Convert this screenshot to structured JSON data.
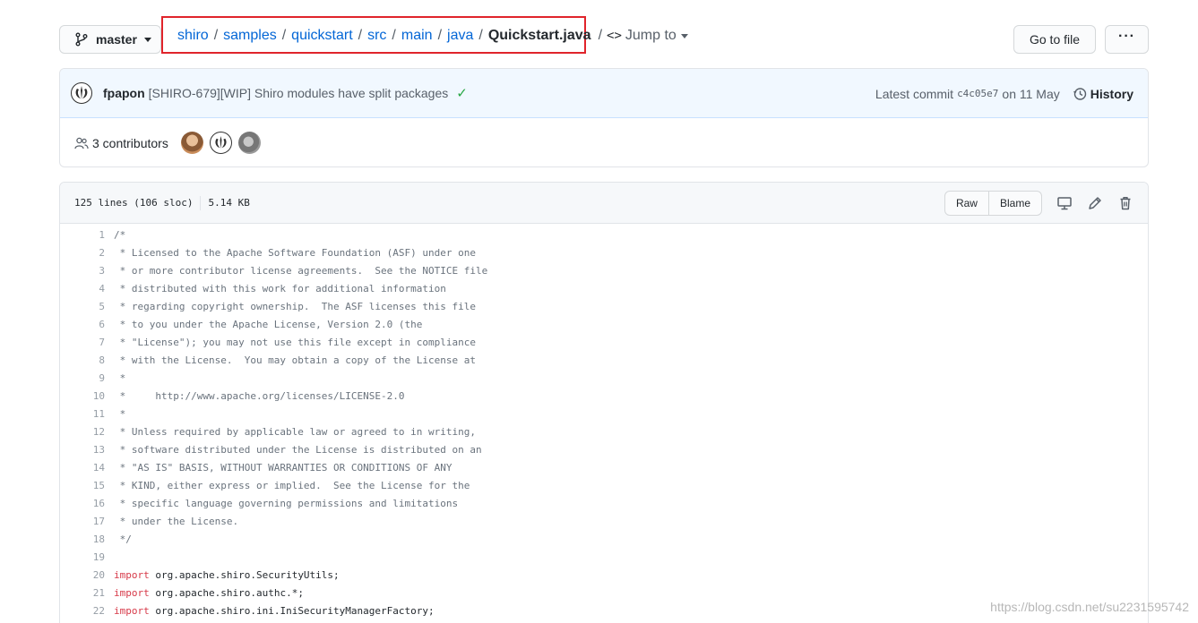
{
  "repo_nav": {
    "branch": "master",
    "breadcrumb": [
      {
        "label": "shiro"
      },
      {
        "label": "samples"
      },
      {
        "label": "quickstart"
      },
      {
        "label": "src"
      },
      {
        "label": "main"
      },
      {
        "label": "java"
      }
    ],
    "file_name": "Quickstart.java",
    "separator": "/",
    "jump_to": "Jump to",
    "go_to_file": "Go to file",
    "more": "···"
  },
  "commit": {
    "author": "fpapon",
    "message": "[SHIRO-679][WIP] Shiro modules have split packages",
    "latest_label": "Latest commit",
    "sha": "c4c05e7",
    "date": "on 11 May",
    "history": "History"
  },
  "contributors": {
    "label": "3 contributors"
  },
  "file": {
    "lines_info": "125 lines (106 sloc)",
    "size": "5.14 KB",
    "raw": "Raw",
    "blame": "Blame"
  },
  "code_lines": [
    {
      "n": "1",
      "text": "/*"
    },
    {
      "n": "2",
      "text": " * Licensed to the Apache Software Foundation (ASF) under one"
    },
    {
      "n": "3",
      "text": " * or more contributor license agreements.  See the NOTICE file"
    },
    {
      "n": "4",
      "text": " * distributed with this work for additional information"
    },
    {
      "n": "5",
      "text": " * regarding copyright ownership.  The ASF licenses this file"
    },
    {
      "n": "6",
      "text": " * to you under the Apache License, Version 2.0 (the"
    },
    {
      "n": "7",
      "text": " * \"License\"); you may not use this file except in compliance"
    },
    {
      "n": "8",
      "text": " * with the License.  You may obtain a copy of the License at"
    },
    {
      "n": "9",
      "text": " *"
    },
    {
      "n": "10",
      "text": " *     http://www.apache.org/licenses/LICENSE-2.0"
    },
    {
      "n": "11",
      "text": " *"
    },
    {
      "n": "12",
      "text": " * Unless required by applicable law or agreed to in writing,"
    },
    {
      "n": "13",
      "text": " * software distributed under the License is distributed on an"
    },
    {
      "n": "14",
      "text": " * \"AS IS\" BASIS, WITHOUT WARRANTIES OR CONDITIONS OF ANY"
    },
    {
      "n": "15",
      "text": " * KIND, either express or implied.  See the License for the"
    },
    {
      "n": "16",
      "text": " * specific language governing permissions and limitations"
    },
    {
      "n": "17",
      "text": " * under the License."
    },
    {
      "n": "18",
      "text": " */"
    },
    {
      "n": "19",
      "text": ""
    },
    {
      "n": "20",
      "kw": "import",
      "text": " org.apache.shiro.SecurityUtils;"
    },
    {
      "n": "21",
      "kw": "import",
      "text": " org.apache.shiro.authc.*;"
    },
    {
      "n": "22",
      "kw": "import",
      "text": " org.apache.shiro.ini.IniSecurityManagerFactory;"
    }
  ],
  "watermark": "https://blog.csdn.net/su2231595742",
  "colors": {
    "link": "#0366d6",
    "highlight_border": "#e0242b",
    "keyword": "#d73a49",
    "check": "#28a745"
  }
}
